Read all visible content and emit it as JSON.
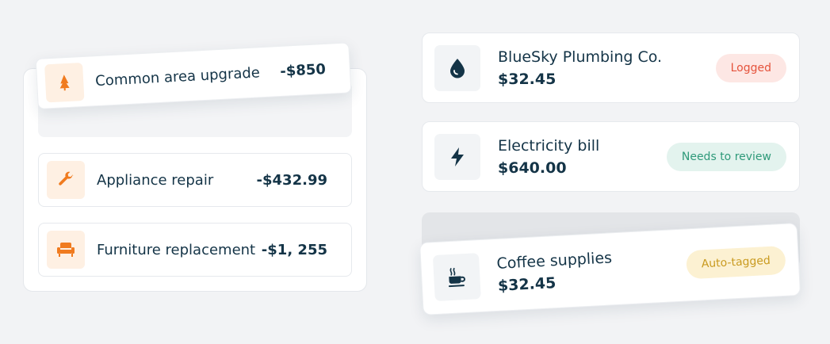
{
  "colors": {
    "logged_bg": "#fde7e4",
    "logged_fg": "#e5533c",
    "review_bg": "#e3f3ee",
    "review_fg": "#2f9a7a",
    "auto_bg": "#fcf1d2",
    "auto_fg": "#c99a1f",
    "expense_icon": "#f07b1f",
    "bill_icon": "#143447"
  },
  "expenses": [
    {
      "label": "Common area upgrade",
      "amount": "-$850",
      "icon": "tree-icon"
    },
    {
      "label": "Appliance repair",
      "amount": "-$432.99",
      "icon": "wrench-icon"
    },
    {
      "label": "Furniture replacement",
      "amount": "-$1, 255",
      "icon": "armchair-icon"
    }
  ],
  "bills": [
    {
      "name": "BlueSky Plumbing Co.",
      "amount": "$32.45",
      "badge": "Logged",
      "icon": "water-drop-icon"
    },
    {
      "name": "Electricity bill",
      "amount": "$640.00",
      "badge": "Needs to review",
      "icon": "lightning-icon"
    },
    {
      "name": "Coffee supplies",
      "amount": "$32.45",
      "badge": "Auto-tagged",
      "icon": "coffee-cup-icon"
    }
  ]
}
